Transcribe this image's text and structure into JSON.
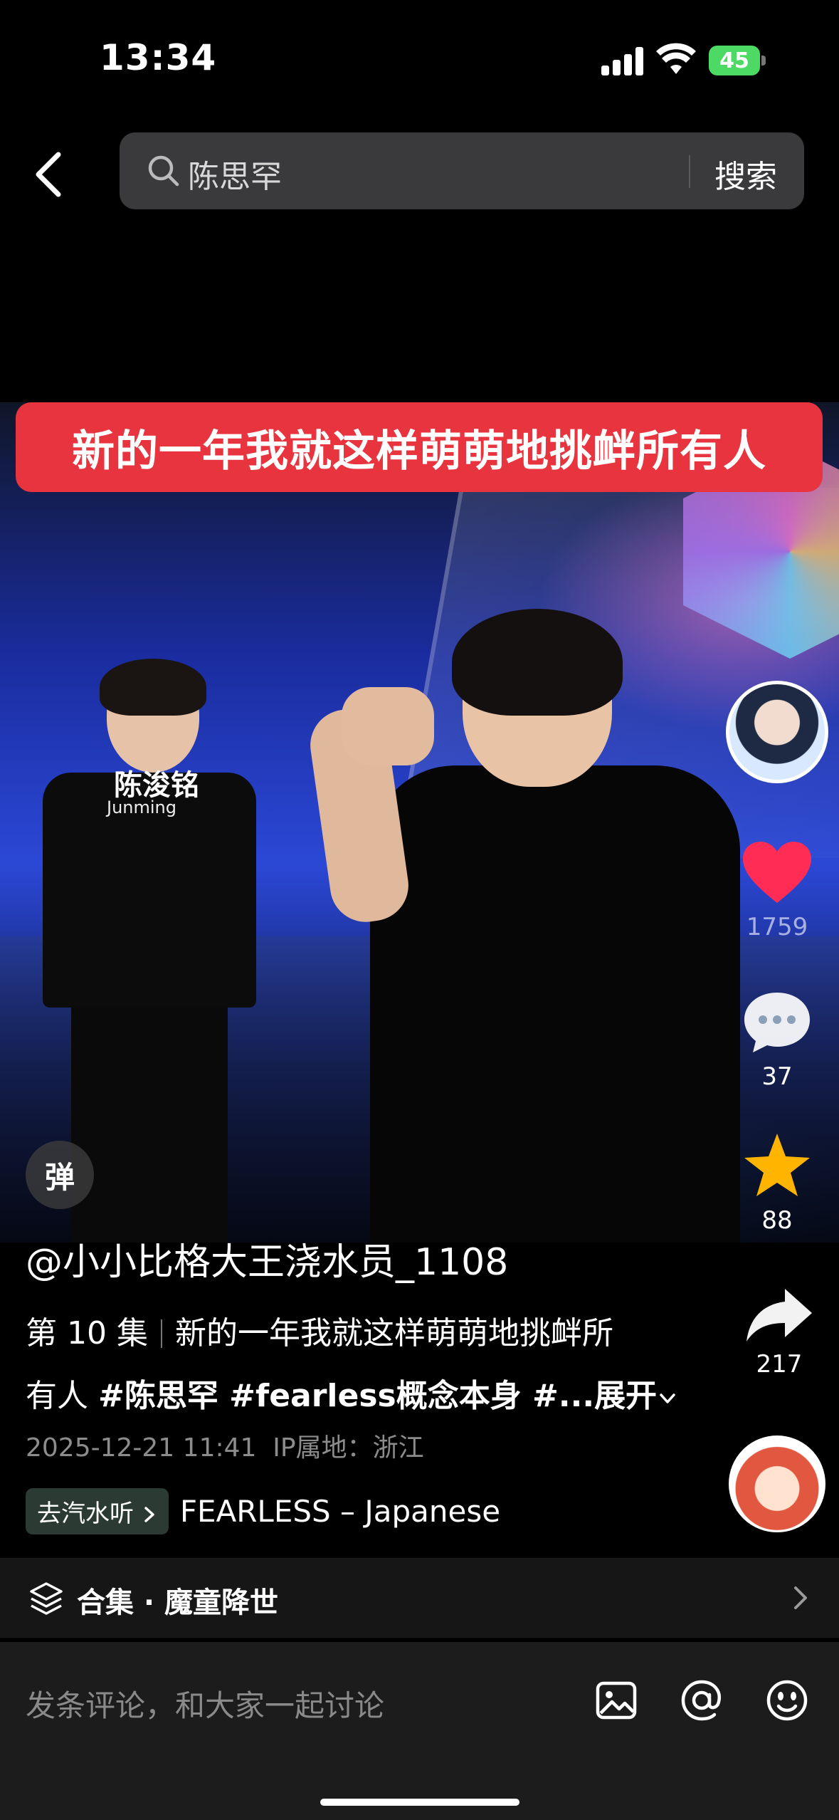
{
  "status_bar": {
    "time": "13:34",
    "battery": "45"
  },
  "search": {
    "query": "陈思罕",
    "button_label": "搜索"
  },
  "video": {
    "caption": "新的一年我就这样萌萌地挑衅所有人",
    "shirt_text": "陈浚铭",
    "shirt_sub": "Junming",
    "danmaku_label": "弹"
  },
  "rail": {
    "likes": "1759",
    "comments": "37",
    "favorites": "88",
    "shares": "217"
  },
  "info": {
    "author": "@小小比格大王浇水员_1108",
    "episode": "第 10 集",
    "title_line1": "新的一年我就这样萌萌地挑衅所",
    "title_line2_prefix": "有人 ",
    "hashtags": "#陈思罕 #fearless概念本身 #...",
    "expand": "展开",
    "timestamp": "2025-12-21 11:41",
    "ip_location": "IP属地：浙江",
    "music_tag": "去汽水听",
    "music_title": "FEARLESS – Japanese"
  },
  "collection": {
    "label": "合集 · 魔童降世"
  },
  "comment": {
    "placeholder": "发条评论，和大家一起讨论"
  },
  "colors": {
    "like": "#ff2d55",
    "favorite": "#ffb400",
    "caption_bg": "#e8343f",
    "battery": "#4cd964"
  },
  "icons": [
    "back-icon",
    "search-icon",
    "heart-icon",
    "comment-icon",
    "star-icon",
    "share-icon",
    "collection-icon",
    "chevron-right-icon",
    "image-icon",
    "at-icon",
    "emoji-icon"
  ]
}
